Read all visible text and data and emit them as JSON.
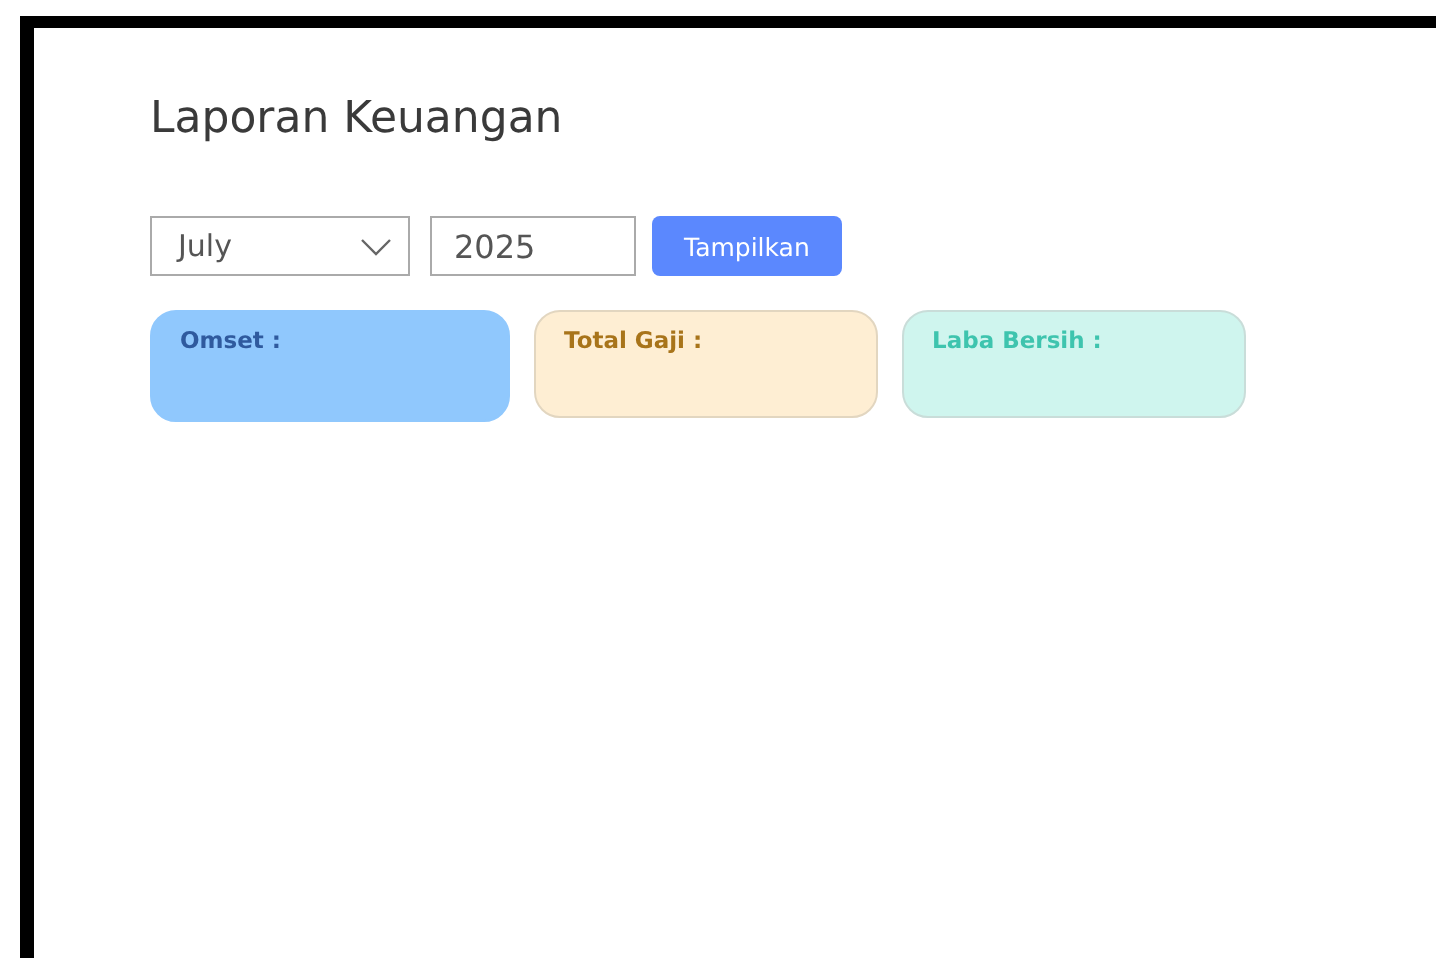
{
  "page": {
    "title": "Laporan Keuangan"
  },
  "filter": {
    "month": "July",
    "year": "2025",
    "button": "Tampilkan"
  },
  "cards": [
    {
      "label": "Omset :",
      "kind": "revenue",
      "color": "#90c8fd"
    },
    {
      "label": "Total Gaji :",
      "kind": "salary",
      "color": "#feeed3"
    },
    {
      "label": "Laba Bersih :",
      "kind": "profit",
      "color": "#cff5ee"
    }
  ]
}
